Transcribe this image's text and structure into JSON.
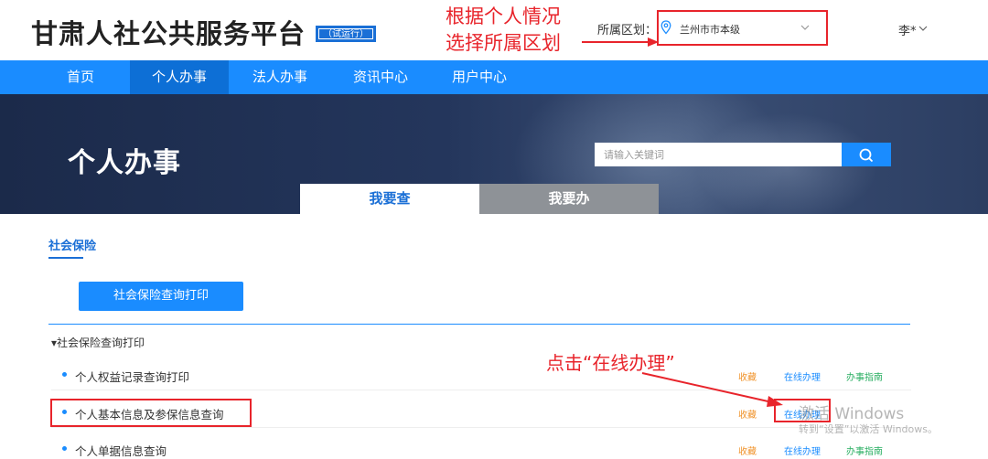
{
  "header": {
    "site_title": "甘肃人社公共服务平台",
    "badge": "试运行",
    "region_label": "所属区划：",
    "region_value": "兰州市市本级",
    "user_name": "李*"
  },
  "annotations": {
    "region_line1": "根据个人情况",
    "region_line2": "选择所属区划",
    "click_hint": "点击“在线办理”",
    "color": "#e8242b"
  },
  "nav": {
    "items": [
      "首页",
      "个人办事",
      "法人办事",
      "资讯中心",
      "用户中心"
    ],
    "active_index": 1
  },
  "banner": {
    "title": "个人办事",
    "search_placeholder": "请输入关键词",
    "tabs": [
      "我要查",
      "我要办"
    ]
  },
  "content": {
    "section_tab": "社会保险",
    "primary_button": "社会保险查询打印",
    "group_header": "▾社会保险查询打印",
    "rows": [
      {
        "label": "个人权益记录查询打印",
        "collect": "收藏",
        "online": "在线办理",
        "guide": "办事指南"
      },
      {
        "label": "个人基本信息及参保信息查询",
        "collect": "收藏",
        "online": "在线办理",
        "guide": ""
      },
      {
        "label": "个人单据信息查询",
        "collect": "收藏",
        "online": "在线办理",
        "guide": "办事指南"
      }
    ]
  },
  "watermark": {
    "line1": "激活 Windows",
    "line2": "转到“设置”以激活 Windows。"
  },
  "colors": {
    "nav": "#1a8cff",
    "accent": "#1a6fd6",
    "collect": "#f0932b",
    "guide": "#27ae60"
  }
}
